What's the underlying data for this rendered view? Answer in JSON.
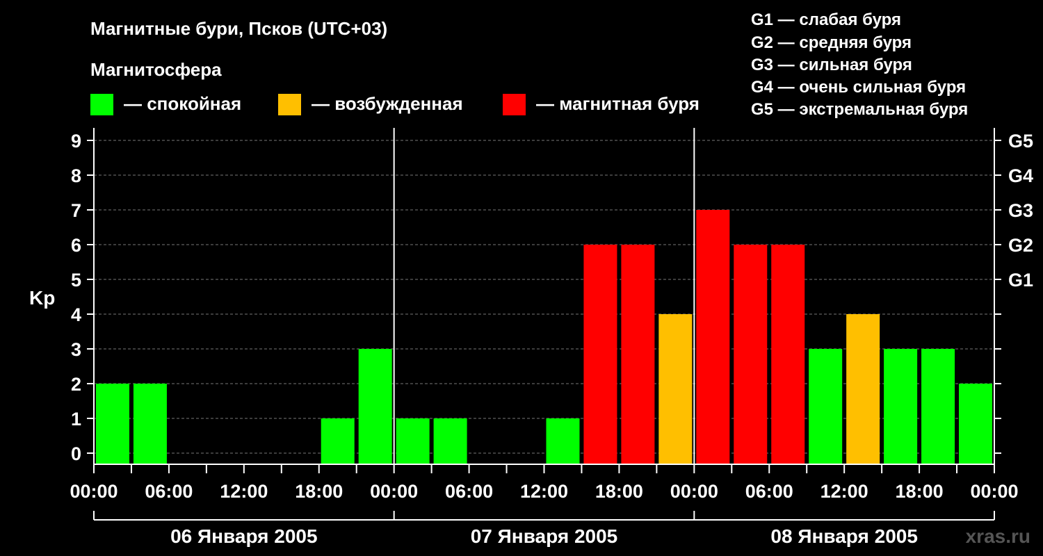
{
  "title": "Магнитные бури, Псков (UTC+03)",
  "legend": {
    "heading": "Магнитосфера",
    "items": [
      {
        "label": "— спокойная",
        "color": "#00ff00"
      },
      {
        "label": "— возбужденная",
        "color": "#ffbf00"
      },
      {
        "label": "— магнитная буря",
        "color": "#ff0000"
      }
    ]
  },
  "g_scale": [
    "G1 — слабая буря",
    "G2 — средняя буря",
    "G3 — сильная буря",
    "G4 — очень сильная буря",
    "G5 — экстремальная буря"
  ],
  "watermark": "xras.ru",
  "chart_data": {
    "type": "bar",
    "title": "Магнитные бури, Псков (UTC+03)",
    "ylabel": "Kp",
    "ylim": [
      0,
      9
    ],
    "grid": true,
    "y_ticks": [
      "0",
      "1",
      "2",
      "3",
      "4",
      "5",
      "6",
      "7",
      "8",
      "9"
    ],
    "right_ticks": [
      {
        "value": 5,
        "label": "G1"
      },
      {
        "value": 6,
        "label": "G2"
      },
      {
        "value": 7,
        "label": "G3"
      },
      {
        "value": 8,
        "label": "G4"
      },
      {
        "value": 9,
        "label": "G5"
      }
    ],
    "x_tick_labels": [
      "00:00",
      "06:00",
      "12:00",
      "18:00",
      "00:00",
      "06:00",
      "12:00",
      "18:00",
      "00:00",
      "06:00",
      "12:00",
      "18:00",
      "00:00"
    ],
    "days": [
      "06 Января 2005",
      "07 Января 2005",
      "08 Января 2005"
    ],
    "interval_hours": 3,
    "values": [
      2,
      2,
      0,
      0,
      0,
      0,
      1,
      3,
      1,
      1,
      0,
      0,
      1,
      6,
      6,
      4,
      7,
      6,
      6,
      3,
      4,
      3,
      3,
      2
    ],
    "levels": [
      "quiet",
      "quiet",
      "quiet",
      "quiet",
      "quiet",
      "quiet",
      "quiet",
      "quiet",
      "quiet",
      "quiet",
      "quiet",
      "quiet",
      "quiet",
      "storm",
      "storm",
      "active",
      "storm",
      "storm",
      "storm",
      "quiet",
      "active",
      "quiet",
      "quiet",
      "quiet"
    ],
    "level_colors": {
      "quiet": "#00ff00",
      "active": "#ffbf00",
      "storm": "#ff0000"
    }
  }
}
